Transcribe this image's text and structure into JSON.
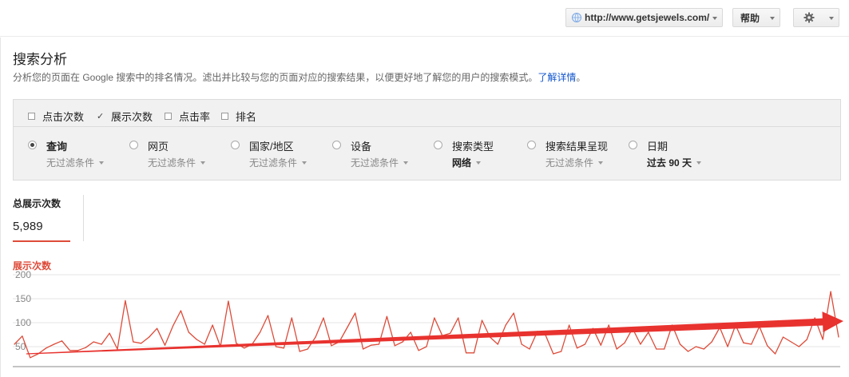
{
  "topbar": {
    "site_url": "http://www.getsjewels.com/",
    "help_label": "帮助",
    "settings_icon": "gear-icon",
    "site_icon": "globe-icon"
  },
  "page": {
    "title": "搜索分析",
    "description": "分析您的页面在 Google 搜索中的排名情况。滤出并比较与您的页面对应的搜索结果，以便更好地了解您的用户的搜索模式。",
    "learn_more": "了解详情",
    "desc_end": "。"
  },
  "metrics": [
    {
      "label": "点击次数",
      "checked": false
    },
    {
      "label": "展示次数",
      "checked": true
    },
    {
      "label": "点击率",
      "checked": false
    },
    {
      "label": "排名",
      "checked": false
    }
  ],
  "groups": [
    {
      "label": "查询",
      "filter": "无过滤条件",
      "selected": true
    },
    {
      "label": "网页",
      "filter": "无过滤条件",
      "selected": false
    },
    {
      "label": "国家/地区",
      "filter": "无过滤条件",
      "selected": false
    },
    {
      "label": "设备",
      "filter": "无过滤条件",
      "selected": false
    },
    {
      "label": "搜索类型",
      "filter": "网络",
      "selected": false
    },
    {
      "label": "搜索结果呈现",
      "filter": "无过滤条件",
      "selected": false
    },
    {
      "label": "日期",
      "filter": "过去 90 天",
      "selected": false
    }
  ],
  "totals": {
    "label": "总展示次数",
    "value": "5,989"
  },
  "colors": {
    "accent": "#dd4b39",
    "line": "#dd4b39",
    "link": "#1155cc"
  },
  "chart_data": {
    "type": "line",
    "title": "展示次数",
    "ylim": [
      0,
      200
    ],
    "yticks": [
      "200",
      "150",
      "100",
      "50"
    ],
    "grid": true,
    "series": [
      {
        "name": "展示次数",
        "values": [
          55,
          72,
          27,
          35,
          47,
          55,
          62,
          42,
          42,
          48,
          60,
          55,
          78,
          45,
          146,
          60,
          57,
          70,
          88,
          53,
          93,
          125,
          80,
          65,
          55,
          95,
          50,
          145,
          57,
          47,
          55,
          80,
          115,
          50,
          47,
          110,
          40,
          45,
          70,
          110,
          52,
          60,
          90,
          120,
          45,
          53,
          55,
          113,
          52,
          60,
          80,
          42,
          50,
          110,
          73,
          78,
          110,
          37,
          37,
          105,
          70,
          55,
          95,
          120,
          55,
          45,
          82,
          75,
          35,
          40,
          95,
          47,
          55,
          88,
          53,
          95,
          45,
          58,
          88,
          55,
          80,
          45,
          45,
          95,
          55,
          40,
          50,
          45,
          60,
          90,
          50,
          95,
          58,
          55,
          92,
          52,
          35,
          70,
          60,
          50,
          65,
          110,
          65,
          165,
          70
        ]
      }
    ],
    "annotation": "upward-trend-arrow"
  }
}
